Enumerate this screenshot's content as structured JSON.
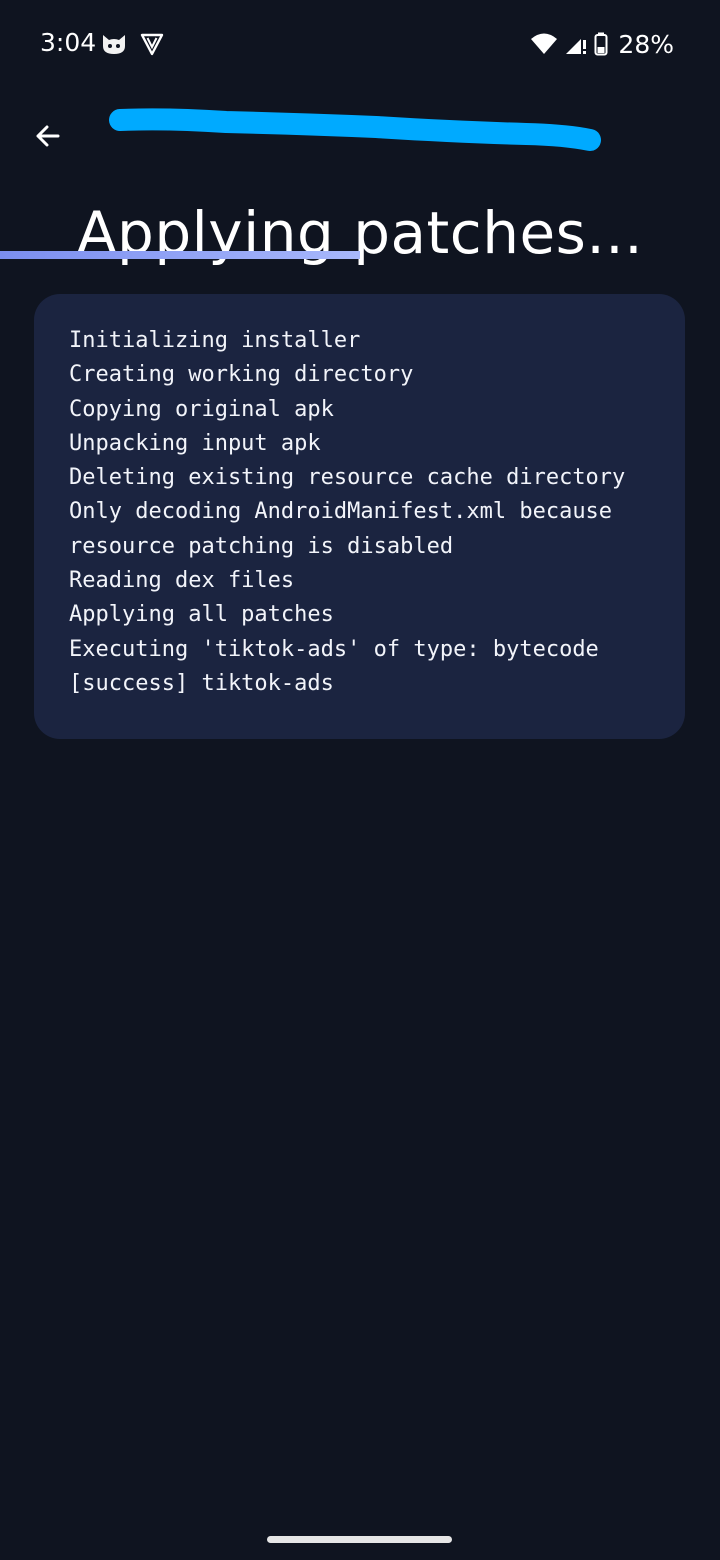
{
  "status_bar": {
    "time": "3:04",
    "app_icons": [
      "cat-face-icon",
      "revanced-v-icon"
    ],
    "system_icons": [
      "wifi-icon",
      "signal-icon",
      "battery-icon"
    ],
    "battery_percent": "28%"
  },
  "header": {
    "back_icon": "arrow-left-icon",
    "title": "Applying patches..."
  },
  "progress": {
    "fraction": 0.5,
    "colors": [
      "#7b8ef0",
      "#a8b8fb"
    ]
  },
  "log": {
    "lines": [
      "Initializing installer",
      "Creating working directory",
      "Copying original apk",
      "Unpacking input apk",
      "Deleting existing resource cache directory",
      "Only decoding AndroidManifest.xml because",
      "resource patching is disabled",
      "Reading dex files",
      "Applying all patches",
      "Executing 'tiktok-ads' of type: bytecode",
      "[success] tiktok-ads"
    ]
  },
  "colors": {
    "background": "#0f1420",
    "card": "#1b2440",
    "redaction": "#00aaff"
  }
}
